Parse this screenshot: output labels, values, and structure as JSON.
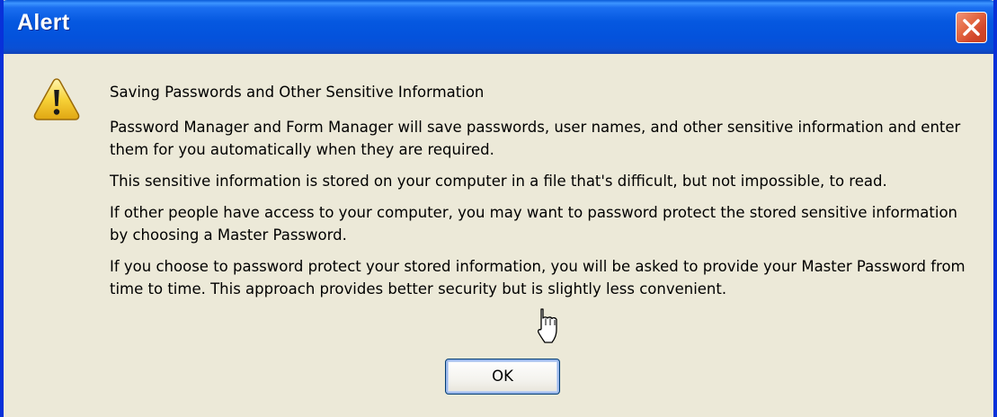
{
  "window": {
    "title": "Alert"
  },
  "dialog": {
    "heading": "Saving Passwords and Other Sensitive Information",
    "paragraphs": [
      "Password Manager and Form Manager will save passwords, user names, and other sensitive information and enter them for you automatically when they are required.",
      "This sensitive information is stored on your computer in a file that's difficult, but not impossible, to read.",
      "If other people have access to your computer, you may want to password protect the stored sensitive information by choosing a Master Password.",
      "If you choose to password protect your stored information, you will be asked to provide your Master Password from time to time. This approach provides better security but is slightly less convenient."
    ],
    "ok_label": "OK"
  },
  "icons": {
    "close": "close-icon",
    "warning": "warning-icon",
    "cursor": "mouse-pointer-icon"
  },
  "colors": {
    "titlebar": "#0558e0",
    "dialog_bg": "#ece9d8",
    "close_button": "#d2462b",
    "warning_fill": "#f7d238"
  }
}
